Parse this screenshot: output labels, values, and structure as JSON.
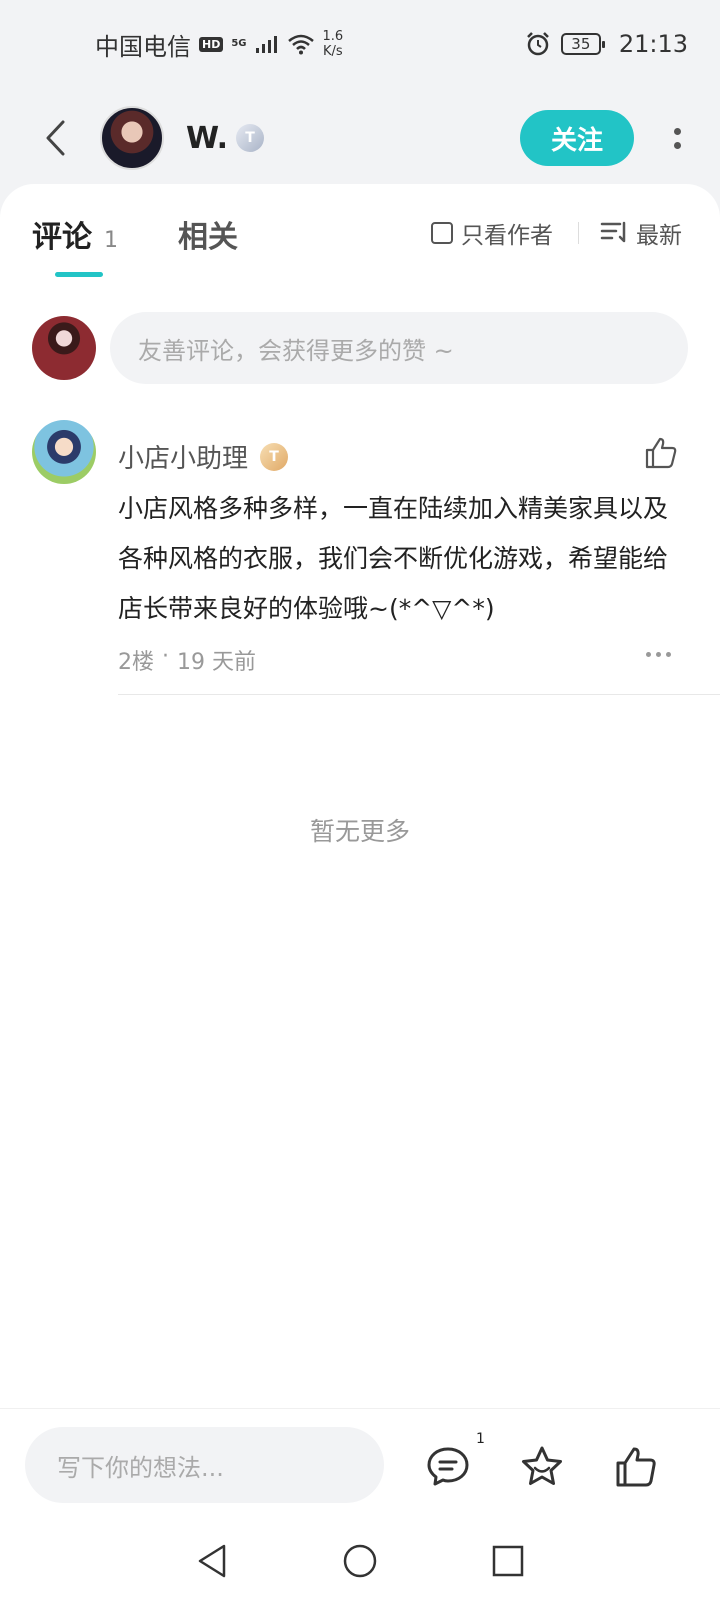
{
  "status_bar": {
    "carrier": "中国电信",
    "hd": "HD",
    "signal_5g": "5G",
    "net_speed_value": "1.6",
    "net_speed_unit": "K/s",
    "battery": "35",
    "time": "21:13"
  },
  "header": {
    "username": "W.",
    "level_badge": "T",
    "follow_label": "关注"
  },
  "tabs": {
    "comments_label": "评论",
    "comments_count": "1",
    "related_label": "相关",
    "author_only_label": "只看作者",
    "sort_label": "最新"
  },
  "composer": {
    "placeholder": "友善评论，会获得更多的赞 ~"
  },
  "comment": {
    "author": "小店小助理",
    "level_badge": "T",
    "text": "小店风格多种多样，一直在陆续加入精美家具以及各种风格的衣服，我们会不断优化游戏，希望能给店长带来良好的体验哦~(*^▽^*)",
    "floor": "2楼",
    "separator": "·",
    "time": "19 天前"
  },
  "list_end_text": "暂无更多",
  "bottom_bar": {
    "input_placeholder": "写下你的想法...",
    "comment_count": "1"
  },
  "colors": {
    "accent": "#22c4c6",
    "text_primary": "#222222",
    "text_secondary": "#999999",
    "background": "#f2f3f5"
  },
  "icons": [
    "back-arrow-icon",
    "more-vertical-icon",
    "checkbox-icon",
    "sort-icon",
    "thumbs-up-icon",
    "more-horizontal-icon",
    "comment-icon",
    "star-icon",
    "nav-back-icon",
    "nav-home-icon",
    "nav-recents-icon"
  ]
}
